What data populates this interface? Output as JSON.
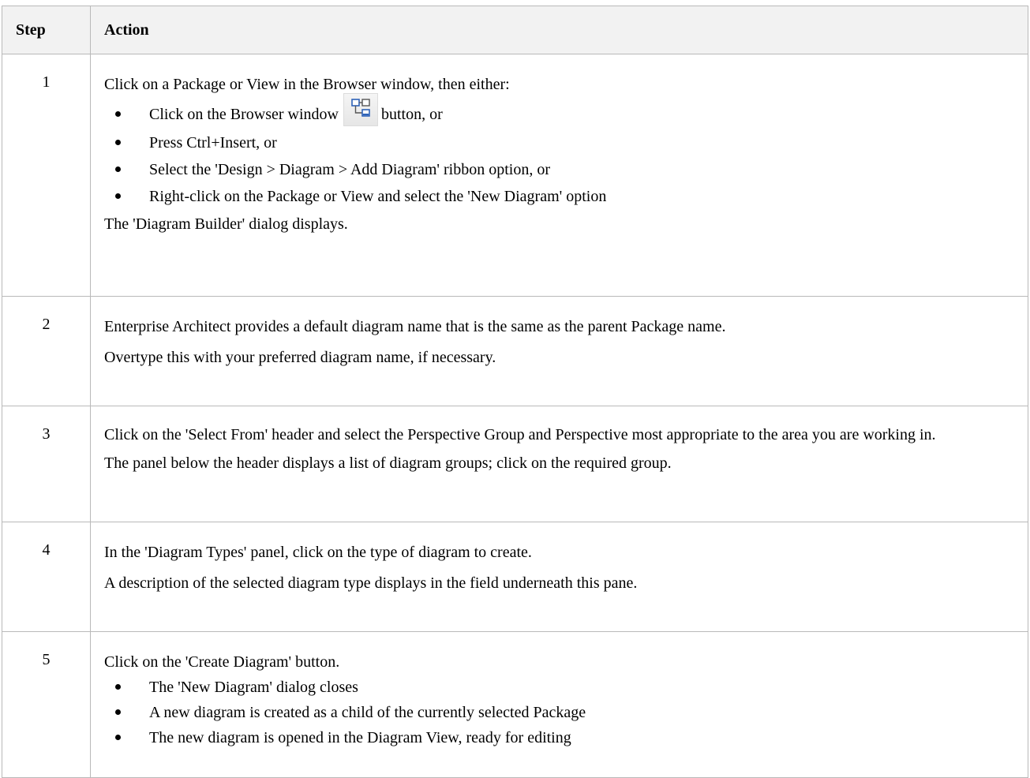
{
  "table": {
    "headers": {
      "step": "Step",
      "action": "Action"
    },
    "rows": [
      {
        "step": "1",
        "intro": "Click on a Package or View in the Browser window, then either:",
        "bullets": [
          {
            "before": "Click on the Browser window",
            "after": "button, or",
            "icon": "new-diagram-icon"
          },
          {
            "text": "Press Ctrl+Insert, or"
          },
          {
            "text": "Select the 'Design > Diagram > Add Diagram' ribbon option, or"
          },
          {
            "text": "Right-click on the Package or View and select the 'New Diagram' option"
          }
        ],
        "outro": "The 'Diagram Builder' dialog displays."
      },
      {
        "step": "2",
        "lines": [
          "Enterprise Architect provides a default diagram name that is the same as the parent Package name.",
          "Overtype this with your preferred diagram name, if necessary."
        ]
      },
      {
        "step": "3",
        "lines": [
          "Click on the 'Select From' header and select the Perspective Group and Perspective most appropriate to the area you are working in.",
          "The panel below the header displays a list of diagram groups; click on the required group."
        ]
      },
      {
        "step": "4",
        "lines": [
          "In the 'Diagram Types' panel, click on the type of diagram to create.",
          "A description of the selected diagram type displays in the field underneath this pane."
        ]
      },
      {
        "step": "5",
        "intro": "Click on the 'Create Diagram' button.",
        "bullets": [
          "The 'New Diagram' dialog closes",
          "A new diagram is created as a child of the currently selected Package",
          "The new diagram is opened in the Diagram View, ready for editing"
        ]
      }
    ]
  },
  "colors": {
    "border": "#b9b9b9",
    "header_bg": "#f2f2f2",
    "icon_blue": "#2f63b8"
  }
}
